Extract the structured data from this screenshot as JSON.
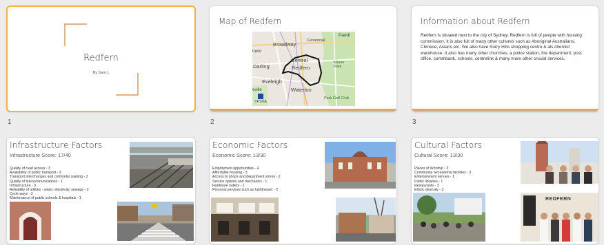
{
  "slides": [
    {
      "number": "1",
      "title": "Redfern",
      "subtitle": "By Sam L"
    },
    {
      "number": "2",
      "title": "Map of Redfern",
      "map": {
        "labels": [
          "Broadway",
          "Central",
          "Redfern",
          "Darling",
          "Eveleigh",
          "Waterloo",
          "Moore Park",
          "Paddi",
          "lown",
          "Centennial",
          "Park Golf Club",
          "eville",
          "©PSMA"
        ]
      }
    },
    {
      "number": "3",
      "title": "Information about Redfern",
      "body": "Redfern is situated next to the city of Sydney. Redfern is full of people with housing commission. It is also full of many other cultures such as Aboriginal Australians, Chinese, Asians etc. We also have Surry Hills shopping centre & als chemist warehouse. It also has many other churches, a police station, fire department, post office, commbank, schools, centrelink & many more other crucial services."
    },
    {
      "number": "",
      "title": "Infrastructure Factors",
      "subtitle": "Infrastructure Score: 17/40",
      "bullets": [
        "Quality of road access - 3",
        "Availability of public transport - 3",
        "Transport interchanges and commuter parking - 2",
        "Quality of telecommunications - 1",
        "Infrastructure - 3",
        "Reliability of utilities - water, electricity, sewage - 2",
        "Cycle ways - 2",
        "Maintenance of public schools & hospitals - 1"
      ]
    },
    {
      "number": "",
      "title": "Economic Factors",
      "subtitle": "Economic Score: 13/30",
      "bullets": [
        "Employment opportunities - 4",
        "Affordable housing - 3",
        "Access to shops and department stores - 2",
        "Service options and mechanics - 1",
        "Hardware outlets - 1",
        "Personal services such as hairdresser - 2"
      ]
    },
    {
      "number": "",
      "title": "Cultural Factors",
      "subtitle": "Cultural Score: 13/30",
      "bullets": [
        "Places of Worship - 3",
        "Community recreational facilities - 3",
        "Entertainment venues - 1",
        "Public libraries - 1",
        "Restaurants - 3",
        "Ethnic diversity - 3"
      ],
      "photo_sign": "REDFERN"
    }
  ]
}
